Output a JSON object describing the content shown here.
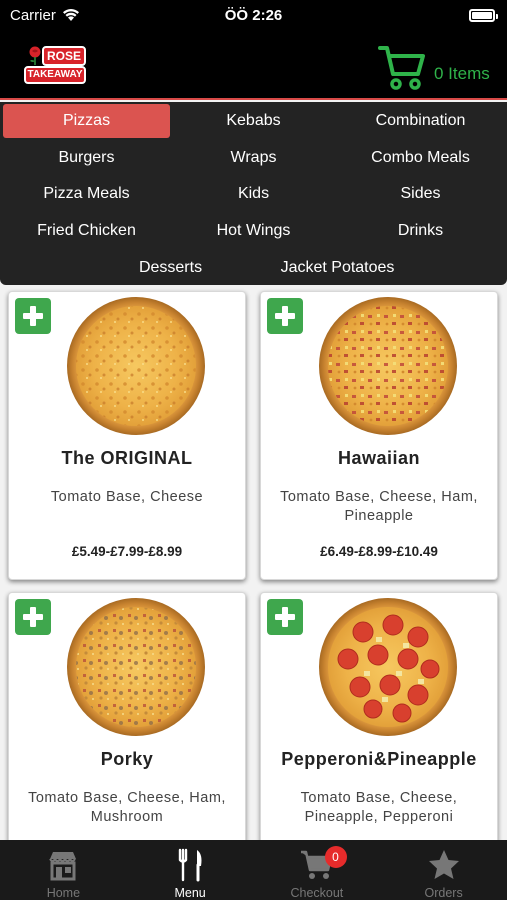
{
  "status_bar": {
    "carrier": "Carrier",
    "time": "ÖÖ 2:26"
  },
  "header": {
    "logo_top": "ROSE",
    "logo_bottom": "TAKEAWAY",
    "cart_label": "0 Items",
    "accent_color": "#d84a47",
    "cart_color": "#2fb34a"
  },
  "categories": [
    {
      "label": "Pizzas",
      "active": true
    },
    {
      "label": "Kebabs"
    },
    {
      "label": "Combination"
    },
    {
      "label": "Burgers"
    },
    {
      "label": "Wraps"
    },
    {
      "label": "Combo Meals"
    },
    {
      "label": "Pizza Meals"
    },
    {
      "label": "Kids"
    },
    {
      "label": "Sides"
    },
    {
      "label": "Fried Chicken"
    },
    {
      "label": "Hot Wings"
    },
    {
      "label": "Drinks"
    },
    {
      "label": "Desserts"
    },
    {
      "label": "Jacket Potatoes"
    }
  ],
  "products": [
    {
      "name": "The ORIGINAL",
      "description": "Tomato Base, Cheese",
      "price": "£5.49-£7.99-£8.99",
      "topping": "cheese"
    },
    {
      "name": "Hawaiian",
      "description": "Tomato Base, Cheese, Ham, Pineapple",
      "price": "£6.49-£8.99-£10.49",
      "topping": "ham"
    },
    {
      "name": "Porky",
      "description": "Tomato Base, Cheese, Ham, Mushroom",
      "price": "",
      "topping": "ham-mushroom"
    },
    {
      "name": "Pepperoni&Pineapple",
      "description": "Tomato Base, Cheese, Pineapple, Pepperoni",
      "price": "",
      "topping": "pepperoni"
    }
  ],
  "tabbar": {
    "tabs": [
      {
        "label": "Home",
        "icon": "store-icon"
      },
      {
        "label": "Menu",
        "icon": "fork-knife-icon",
        "active": true
      },
      {
        "label": "Checkout",
        "icon": "cart-icon",
        "badge": "0"
      },
      {
        "label": "Orders",
        "icon": "star-icon"
      }
    ]
  }
}
